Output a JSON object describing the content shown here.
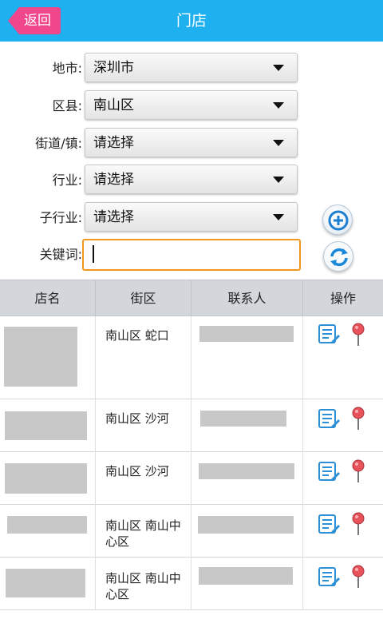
{
  "header": {
    "back_label": "返回",
    "title": "门店"
  },
  "form": {
    "city": {
      "label": "地市:",
      "value": "深圳市"
    },
    "district": {
      "label": "区县:",
      "value": "南山区"
    },
    "street": {
      "label": "街道/镇:",
      "value": "请选择"
    },
    "industry": {
      "label": "行业:",
      "value": "请选择"
    },
    "sub_industry": {
      "label": "子行业:",
      "value": "请选择"
    },
    "keyword": {
      "label": "关键词:",
      "value": ""
    }
  },
  "table": {
    "headers": [
      "店名",
      "街区",
      "联系人",
      "操作"
    ],
    "rows": [
      {
        "district": "南山区 蛇口"
      },
      {
        "district": "南山区 沙河"
      },
      {
        "district": "南山区 沙河"
      },
      {
        "district": "南山区 南山中心区"
      },
      {
        "district": "南山区 南山中心区"
      }
    ]
  },
  "colors": {
    "header": "#1fb0f0",
    "back_button": "#f0468c",
    "keyword_border": "#f39a1e",
    "table_head": "#d3d7db"
  },
  "icons": {
    "add": "plus-circle-icon",
    "refresh": "refresh-icon",
    "edit": "edit-list-icon",
    "location": "map-pin-icon"
  }
}
